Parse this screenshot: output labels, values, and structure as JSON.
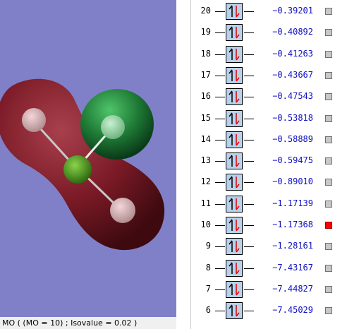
{
  "viewer": {
    "status_text": "MO ( (MO = 10) ; Isovalue = 0.02 )",
    "background_color": "#8080c8",
    "lobe_colors": {
      "negative": "#7a1a26",
      "positive": "#1f7a36"
    }
  },
  "orbitals": [
    {
      "number": "20",
      "energy": "−0.39201",
      "occupied": true,
      "selected": false
    },
    {
      "number": "19",
      "energy": "−0.40892",
      "occupied": true,
      "selected": false
    },
    {
      "number": "18",
      "energy": "−0.41263",
      "occupied": true,
      "selected": false
    },
    {
      "number": "17",
      "energy": "−0.43667",
      "occupied": true,
      "selected": false
    },
    {
      "number": "16",
      "energy": "−0.47543",
      "occupied": true,
      "selected": false
    },
    {
      "number": "15",
      "energy": "−0.53818",
      "occupied": true,
      "selected": false
    },
    {
      "number": "14",
      "energy": "−0.58889",
      "occupied": true,
      "selected": false
    },
    {
      "number": "13",
      "energy": "−0.59475",
      "occupied": true,
      "selected": false
    },
    {
      "number": "12",
      "energy": "−0.89010",
      "occupied": true,
      "selected": false
    },
    {
      "number": "11",
      "energy": "−1.17139",
      "occupied": true,
      "selected": false
    },
    {
      "number": "10",
      "energy": "−1.17368",
      "occupied": true,
      "selected": true
    },
    {
      "number": "9",
      "energy": "−1.28161",
      "occupied": true,
      "selected": false
    },
    {
      "number": "8",
      "energy": "−7.43167",
      "occupied": true,
      "selected": false
    },
    {
      "number": "7",
      "energy": "−7.44827",
      "occupied": true,
      "selected": false
    },
    {
      "number": "6",
      "energy": "−7.45029",
      "occupied": true,
      "selected": false
    }
  ],
  "icons": {
    "electron_pair": "spin-up-down-arrows-icon",
    "selector": "checkbox-icon"
  },
  "colors": {
    "energy_text": "#1010c0",
    "selected_marker": "#ff0000",
    "unselected_marker": "#c8c8c8",
    "occupied_box": "#b9d1ea"
  }
}
